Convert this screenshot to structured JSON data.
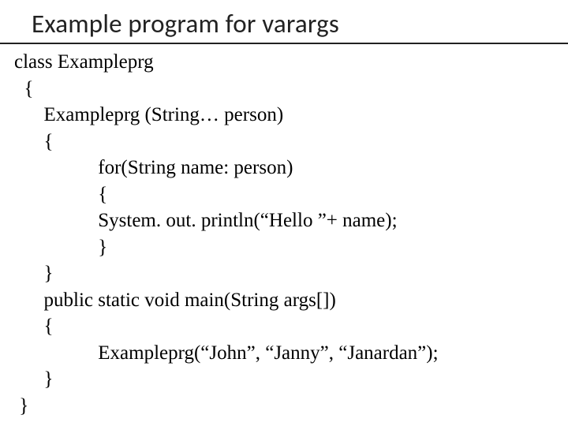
{
  "title": "Example program for varargs",
  "code": "class Exampleprg\n  {\n      Exampleprg (String… person)\n      {\n                 for(String name: person)\n                 {\n                 System. out. println(“Hello ”+ name);\n                 }\n      }\n      public static void main(String args[])\n      {\n                 Exampleprg(“John”, “Janny”, “Janardan”);\n      }\n }"
}
